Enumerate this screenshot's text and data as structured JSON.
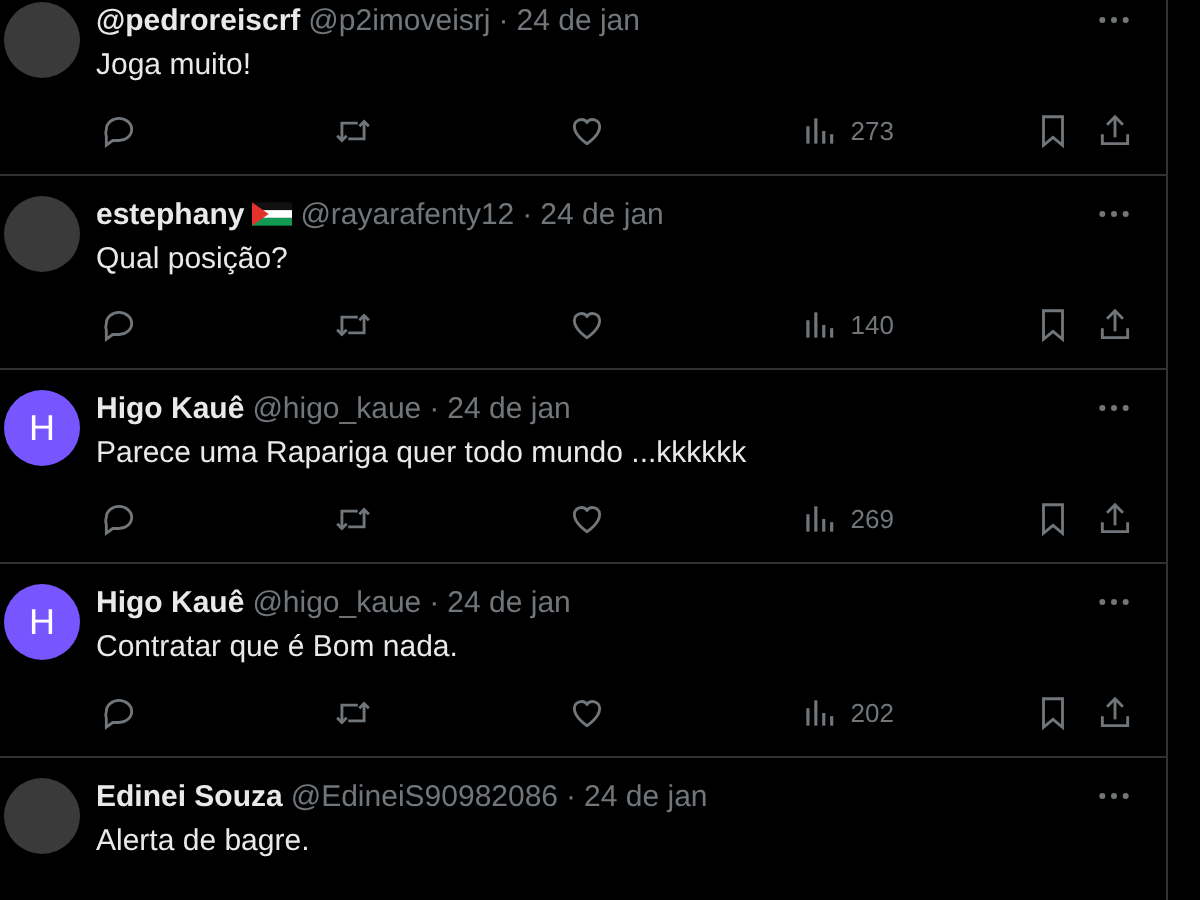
{
  "tweets": [
    {
      "avatar": {
        "kind": "photo"
      },
      "name": "@pedroreiscrf",
      "flag": false,
      "handle": "@p2imoveisrj",
      "separator": "·",
      "time": "24 de jan",
      "text": "Joga muito!",
      "views": "273"
    },
    {
      "avatar": {
        "kind": "photo"
      },
      "name": "estephany",
      "flag": true,
      "handle": "@rayarafenty12",
      "separator": "·",
      "time": "24 de jan",
      "text": "Qual posição?",
      "views": "140"
    },
    {
      "avatar": {
        "kind": "letter",
        "letter": "H",
        "color": "#7856ff"
      },
      "name": "Higo Kauê",
      "flag": false,
      "handle": "@higo_kaue",
      "separator": "·",
      "time": "24 de jan",
      "text": "Parece uma Rapariga quer todo mundo ...kkkkkk",
      "views": "269"
    },
    {
      "avatar": {
        "kind": "letter",
        "letter": "H",
        "color": "#7856ff"
      },
      "name": "Higo Kauê",
      "flag": false,
      "handle": "@higo_kaue",
      "separator": "·",
      "time": "24 de jan",
      "text": "Contratar que é Bom nada.",
      "views": "202"
    },
    {
      "avatar": {
        "kind": "photo"
      },
      "name": "Edinei Souza",
      "flag": false,
      "handle": "@EdineiS90982086",
      "separator": "·",
      "time": "24 de jan",
      "text": "Alerta de bagre."
    }
  ]
}
